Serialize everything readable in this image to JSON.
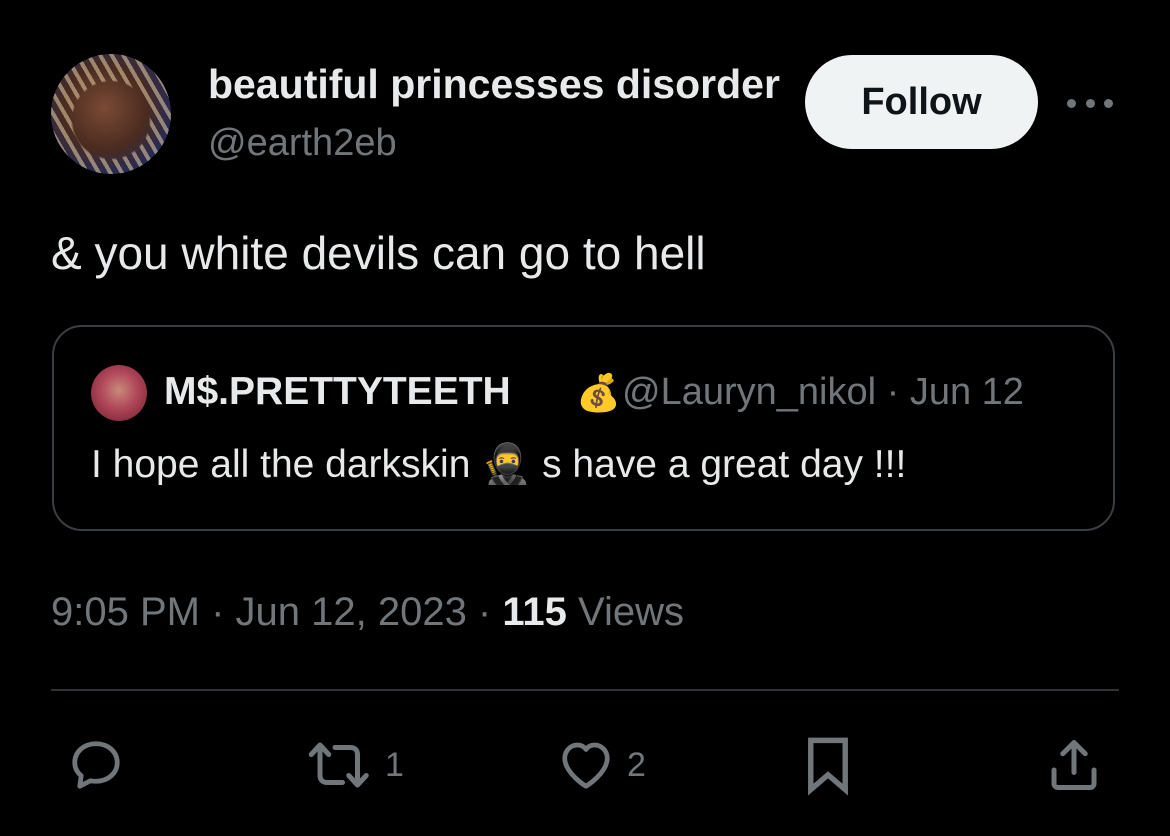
{
  "author": {
    "display_name": "beautiful princesses disorder",
    "handle": "@earth2eb",
    "follow_label": "Follow"
  },
  "tweet": {
    "text": "& you white devils can go to hell"
  },
  "quoted": {
    "display_name": "M$.PRETTYTEETH",
    "name_emoji": "💰",
    "meta": "@Lauryn_nikol · Jun 12",
    "text_before": "I hope all the darkskin",
    "emoji": "🥷",
    "text_after": "s have a great day !!!"
  },
  "timestamp": {
    "time_date": "9:05 PM · Jun 12, 2023 · ",
    "views_count": "115",
    "views_label": " Views"
  },
  "actions": {
    "reply_count": "",
    "retweet_count": "1",
    "like_count": "2"
  },
  "colors": {
    "background": "#000000",
    "text": "#e7e9ea",
    "secondary": "#71767b",
    "border": "#3a3d41"
  }
}
